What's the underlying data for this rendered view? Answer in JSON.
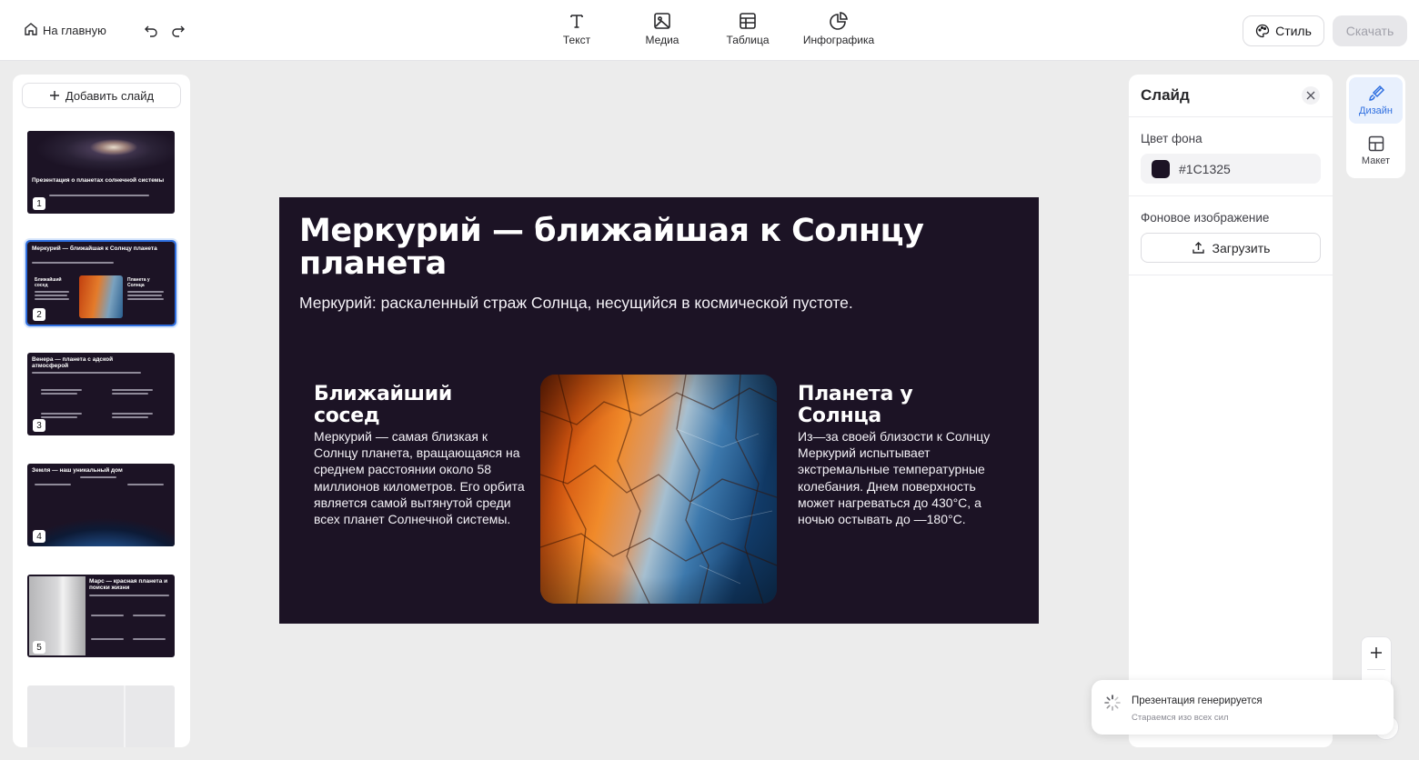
{
  "topbar": {
    "home_label": "На главную",
    "tools": [
      {
        "label": "Текст",
        "icon": "text-icon"
      },
      {
        "label": "Медиа",
        "icon": "image-icon"
      },
      {
        "label": "Таблица",
        "icon": "table-icon"
      },
      {
        "label": "Инфографика",
        "icon": "chart-pie-icon"
      }
    ],
    "style_label": "Стиль",
    "download_label": "Скачать"
  },
  "left_panel": {
    "add_slide_label": "Добавить слайд",
    "thumbnails": [
      {
        "num": "1",
        "title": "Презентация о планетах солнечной системы"
      },
      {
        "num": "2",
        "title": "Меркурий — ближайшая к Солнцу планета"
      },
      {
        "num": "3",
        "title": "Венера — планета с адской атмосферой"
      },
      {
        "num": "4",
        "title": "Земля — наш уникальный дом"
      },
      {
        "num": "5",
        "title": "Марс — красная планета и поиски жизни"
      }
    ],
    "selected_index": 2
  },
  "slide": {
    "background": "#1C1325",
    "title": "Меркурий — ближайшая к Солнцу планета",
    "subtitle": "Меркурий: раскаленный страж Солнца, несущийся в космической пустоте.",
    "left_col": {
      "title": "Ближайший сосед",
      "text": "Меркурий — самая близкая к Солнцу планета, вращающаяся на среднем расстоянии около 58 миллионов километров. Его орбита является самой вытянутой среди всех планет Солнечной системы."
    },
    "right_col": {
      "title": "Планета у Солнца",
      "text": "Из—за своей близости к Солнцу Меркурий испытывает экстремальные температурные колебания. Днем поверхность может нагреваться до 430°C, а ночью остывать до —180°C."
    }
  },
  "right_panel": {
    "title": "Слайд",
    "bg_color_label": "Цвет фона",
    "bg_color_value": "#1C1325",
    "bg_image_label": "Фоновое изображение",
    "upload_label": "Загрузить"
  },
  "side_tabs": [
    {
      "label": "Дизайн",
      "icon": "brush-icon",
      "active": true
    },
    {
      "label": "Макет",
      "icon": "layout-icon",
      "active": false
    }
  ],
  "toast": {
    "title": "Презентация генерируется",
    "subtitle": "Стараемся изо всех сил"
  },
  "colors": {
    "accent": "#2F6FE0",
    "slide_bg": "#1C1325"
  }
}
